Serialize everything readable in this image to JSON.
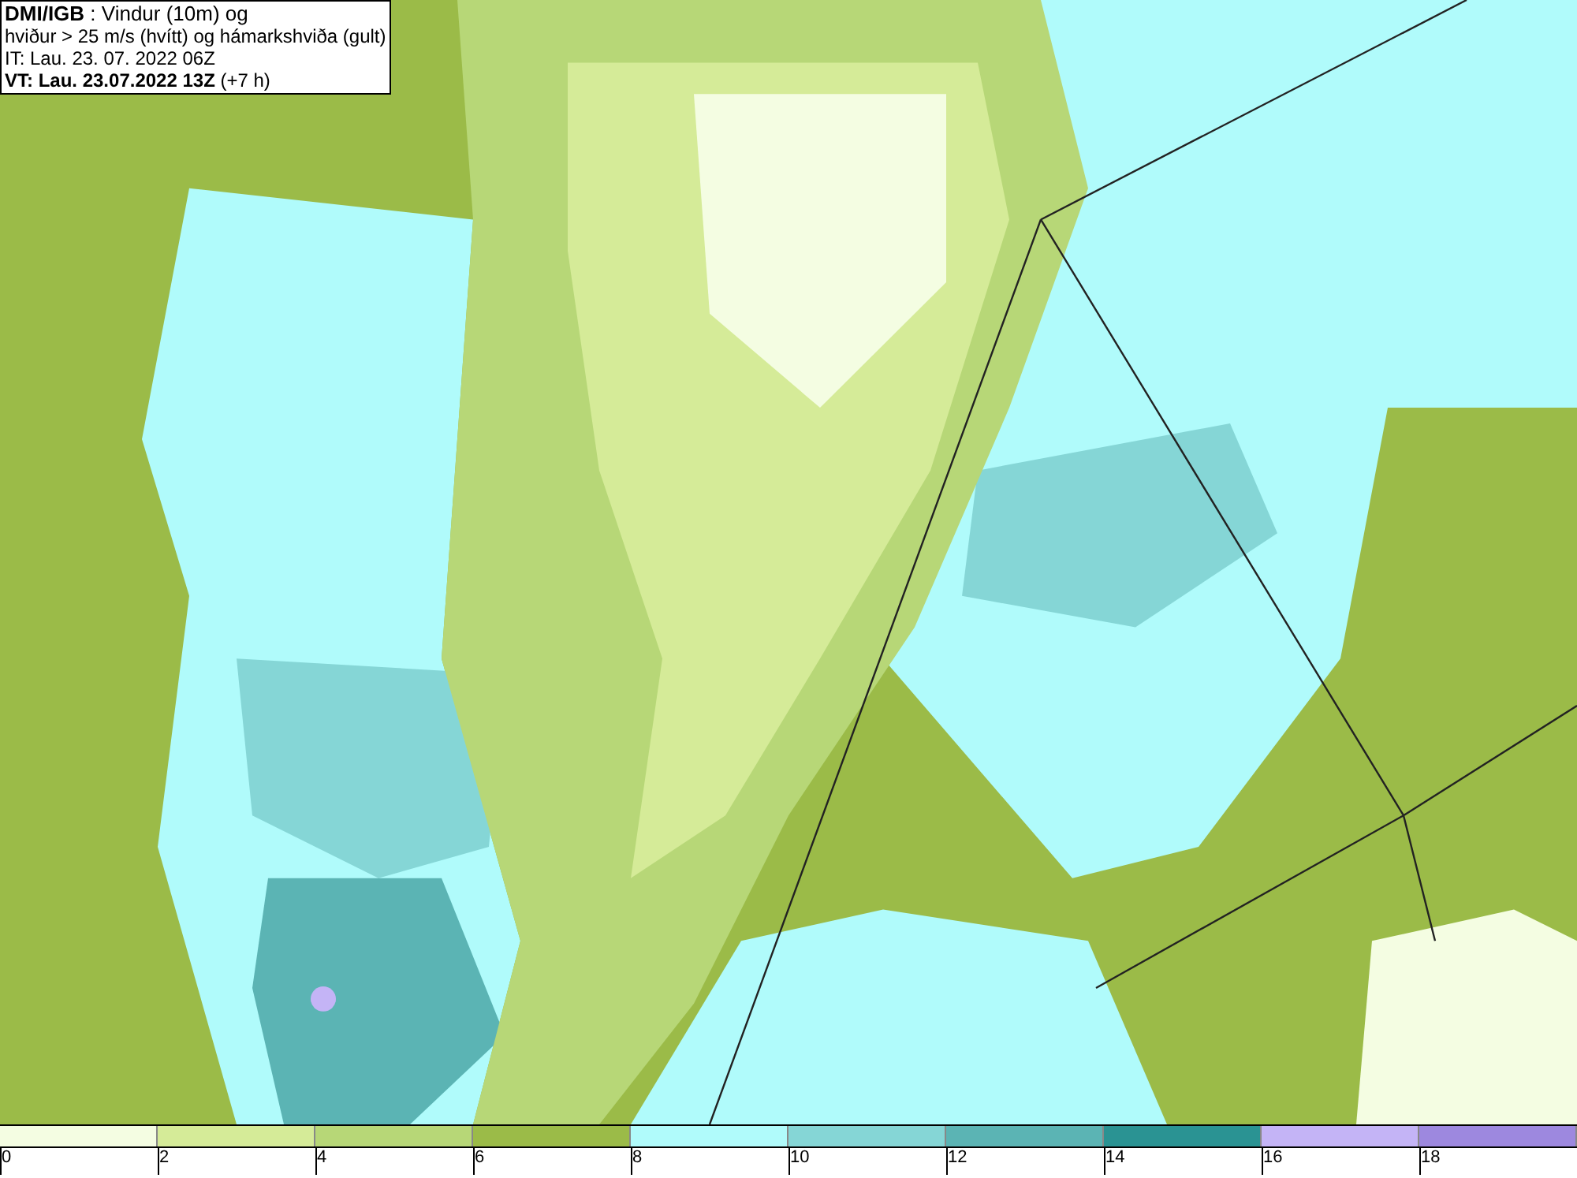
{
  "info_box": {
    "lines": [
      "**DMI/IGB** : Vindur (10m) og",
      "hviður > 25 m/s (hvítt) og hámarkshviða (gult)",
      "IT: Lau. 23. 07. 2022 06Z",
      "**VT: Lau. 23.07.2022 13Z** (+7 h)"
    ]
  },
  "legend": [
    {
      "color": "#f4fde2",
      "label": "0"
    },
    {
      "color": "#d5eb98",
      "label": "2"
    },
    {
      "color": "#b7d777",
      "label": "4"
    },
    {
      "color": "#9bbb48",
      "label": "6"
    },
    {
      "color": "#b0fbfb",
      "label": "8"
    },
    {
      "color": "#85d6d6",
      "label": "10"
    },
    {
      "color": "#5bb4b4",
      "label": "12"
    },
    {
      "color": "#2a9393",
      "label": "14"
    },
    {
      "color": "#c4b4f6",
      "label": "16"
    },
    {
      "color": "#9d88df",
      "label": "18"
    }
  ]
}
